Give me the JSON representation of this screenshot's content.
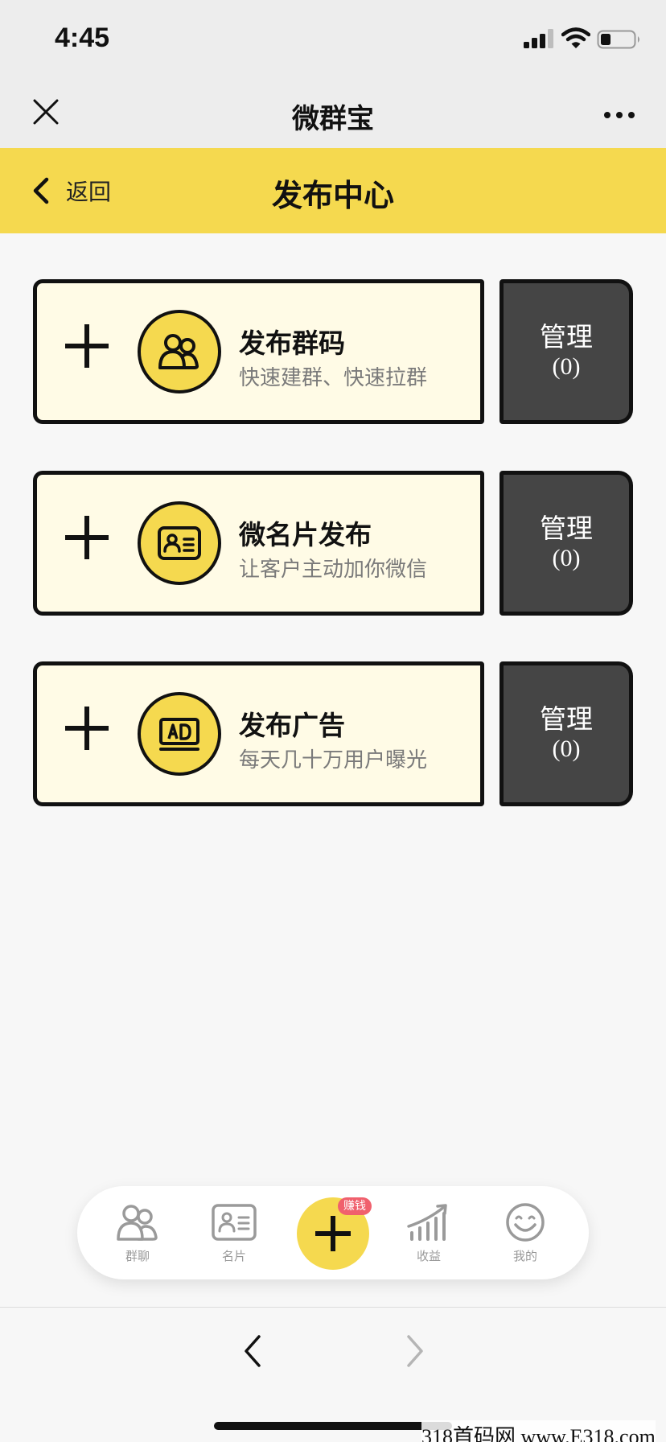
{
  "status_bar": {
    "time": "4:45"
  },
  "wechat_nav": {
    "title": "微群宝"
  },
  "app_header": {
    "back_label": "返回",
    "title": "发布中心"
  },
  "publish_items": [
    {
      "title": "发布群码",
      "subtitle": "快速建群、快速拉群",
      "icon": "group-icon",
      "manage_label": "管理",
      "manage_count": "(0)"
    },
    {
      "title": "微名片发布",
      "subtitle": "让客户主动加你微信",
      "icon": "business-card-icon",
      "manage_label": "管理",
      "manage_count": "(0)"
    },
    {
      "title": "发布广告",
      "subtitle": "每天几十万用户曝光",
      "icon": "ad-icon",
      "manage_label": "管理",
      "manage_count": "(0)"
    }
  ],
  "tab_bar": {
    "items": [
      {
        "label": "群聊",
        "icon": "group-chat-icon"
      },
      {
        "label": "名片",
        "icon": "card-icon"
      },
      {
        "label": "收益",
        "icon": "earnings-chart-icon"
      },
      {
        "label": "我的",
        "icon": "smiley-icon"
      }
    ],
    "center_badge": "赚钱",
    "center_icon": "plus-icon"
  },
  "browser_bar": {
    "watermark": "318首码网 www.E318.com"
  },
  "colors": {
    "accent_yellow": "#f5d94f",
    "card_bg": "#fffbe6",
    "manage_bg": "#454545",
    "badge_red": "#f0606d"
  }
}
